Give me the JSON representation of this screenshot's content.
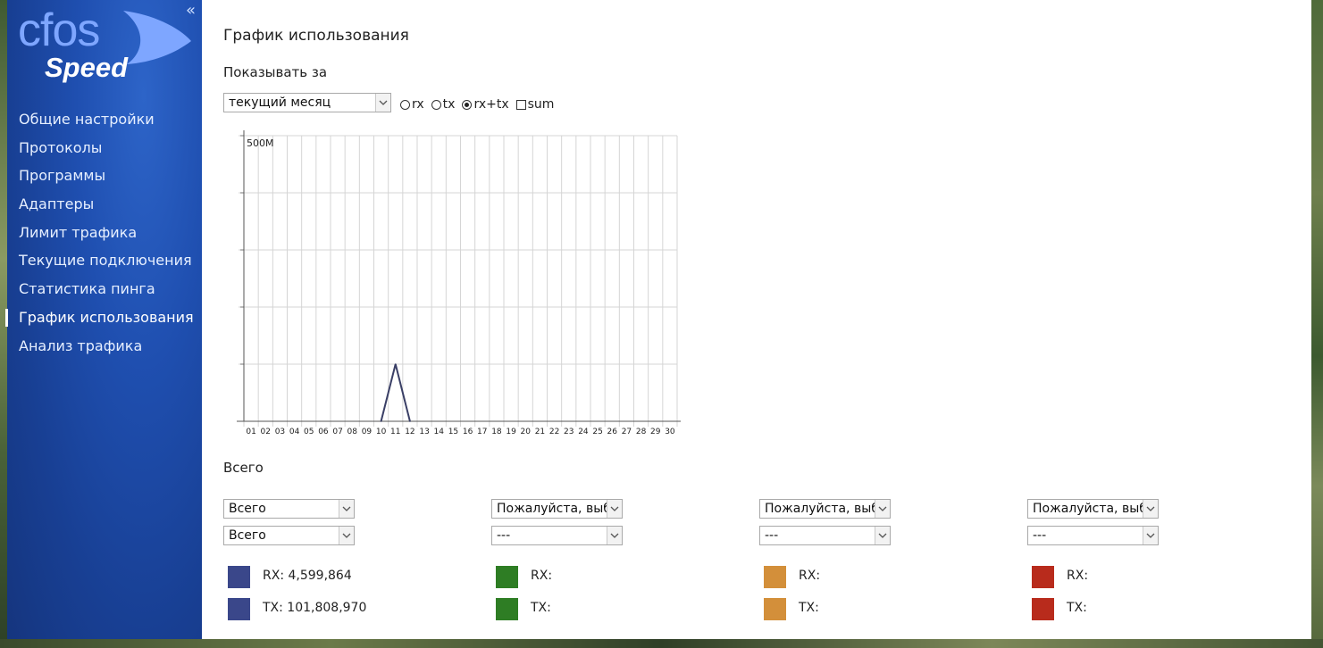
{
  "sidebar": {
    "collapse_glyph": "«",
    "logo": {
      "text_top": "cfos",
      "text_bottom": "Speed"
    },
    "items": [
      {
        "label": "Общие настройки",
        "name": "sidebar-item-general-settings"
      },
      {
        "label": "Протоколы",
        "name": "sidebar-item-protocols"
      },
      {
        "label": "Программы",
        "name": "sidebar-item-programs"
      },
      {
        "label": "Адаптеры",
        "name": "sidebar-item-adapters"
      },
      {
        "label": "Лимит трафика",
        "name": "sidebar-item-traffic-limit"
      },
      {
        "label": "Текущие подключения",
        "name": "sidebar-item-current-connections"
      },
      {
        "label": "Статистика пинга",
        "name": "sidebar-item-ping-statistics"
      },
      {
        "label": "График использования",
        "name": "sidebar-item-usage-graph",
        "active": true
      },
      {
        "label": "Анализ трафика",
        "name": "sidebar-item-traffic-analysis"
      }
    ]
  },
  "main": {
    "title": "График использования",
    "show_for_label": "Показывать за",
    "period_select": {
      "value": "текущий месяц"
    },
    "radios": [
      {
        "label": "rx",
        "checked": false
      },
      {
        "label": "tx",
        "checked": false
      },
      {
        "label": "rx+tx",
        "checked": true
      }
    ],
    "sum_checkbox": {
      "label": "sum",
      "checked": false
    },
    "total_title": "Всего",
    "columns": [
      {
        "select1": "Всего",
        "select2": "Всего",
        "color": "#3a478a",
        "rx": "RX: 4,599,864",
        "tx": "TX: 101,808,970"
      },
      {
        "select1": "Пожалуйста, выберите",
        "select2": "---",
        "color": "#2e7d24",
        "rx": "RX:",
        "tx": "TX:"
      },
      {
        "select1": "Пожалуйста, выберите",
        "select2": "---",
        "color": "#d38f3a",
        "rx": "RX:",
        "tx": "TX:"
      },
      {
        "select1": "Пожалуйста, выберите",
        "select2": "---",
        "color": "#b82b1c",
        "rx": "RX:",
        "tx": "TX:"
      }
    ]
  },
  "chart_data": {
    "type": "line",
    "y_tick_label": "500M",
    "ylim": [
      0,
      500
    ],
    "y_unit": "M",
    "categories": [
      "01",
      "02",
      "03",
      "04",
      "05",
      "06",
      "07",
      "08",
      "09",
      "10",
      "11",
      "12",
      "13",
      "14",
      "15",
      "16",
      "17",
      "18",
      "19",
      "20",
      "21",
      "22",
      "23",
      "24",
      "25",
      "26",
      "27",
      "28",
      "29",
      "30"
    ],
    "series": [
      {
        "color": "#3a3f66",
        "points": [
          {
            "x": "10",
            "y": 0
          },
          {
            "x": "11",
            "y": 100
          },
          {
            "x": "12",
            "y": 0
          }
        ]
      }
    ],
    "grid": true
  }
}
